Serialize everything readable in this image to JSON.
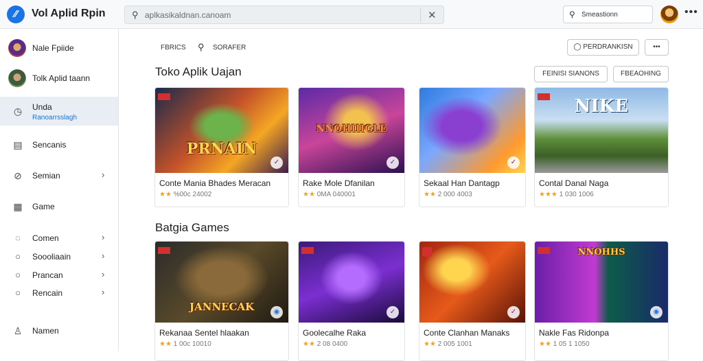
{
  "topbar": {
    "app_title": "Vol Aplid Rpin",
    "search_placeholder": "aplkasikaldnan.canoam",
    "search2_placeholder": "Smeastionn"
  },
  "sidebar": {
    "profiles": [
      {
        "label": "Nale Fpiide"
      },
      {
        "label": "Tolk Aplid taann"
      }
    ],
    "active": {
      "label": "Unda",
      "sublabel": "Ranoarrsslagh"
    },
    "items": [
      {
        "label": "Sencanis",
        "icon": "document-icon",
        "chevron": false
      },
      {
        "label": "Semian",
        "icon": "tag-icon",
        "chevron": true
      },
      {
        "label": "Game",
        "icon": "grid-icon",
        "chevron": false
      }
    ],
    "small_items": [
      {
        "label": "Comen"
      },
      {
        "label": "Soooliaain"
      },
      {
        "label": "Prancan"
      },
      {
        "label": "Rencain"
      }
    ],
    "bottom": {
      "label": "Namen"
    }
  },
  "main": {
    "tab1": "FBRICS",
    "tab2": "SORAFER",
    "btn_primary": "PERDRANKISN",
    "btn_more": "•••",
    "section1_title": "Toko Aplik Uajan",
    "filter1": "FEINISI SIANONS",
    "filter2": "FBEAOHING",
    "section2_title": "Batgia Games",
    "row1": [
      {
        "title": "Conte Mania Bhades Meracan",
        "stars": "★★",
        "rating": "%00c 24002",
        "art_text": "PRNAIN"
      },
      {
        "title": "Rake Mole Dfanilan",
        "stars": "★★",
        "rating": "0MA 040001",
        "art_text": "NNOHIIIGLE"
      },
      {
        "title": "Sekaal Han Dantagp",
        "stars": "★★",
        "rating": "2 000 4003",
        "art_text": ""
      },
      {
        "title": "Contal Danal Naga",
        "stars": "★★★",
        "rating": "1 030 1006",
        "art_text": "NIKE"
      }
    ],
    "row2": [
      {
        "title": "Rekanaa Sentel hlaakan",
        "stars": "★★",
        "rating": "1 00c 10010",
        "art_text": "JANNECAK"
      },
      {
        "title": "Goolecalhe Raka",
        "stars": "★★",
        "rating": "2 08 0400",
        "art_text": ""
      },
      {
        "title": "Conte Clanhan Manaks",
        "stars": "★★",
        "rating": "2 005 1001",
        "art_text": ""
      },
      {
        "title": "Nakle Fas Ridonpa",
        "stars": "★★",
        "rating": "1 05 1 1050",
        "art_text": "NNOHHS"
      }
    ]
  }
}
